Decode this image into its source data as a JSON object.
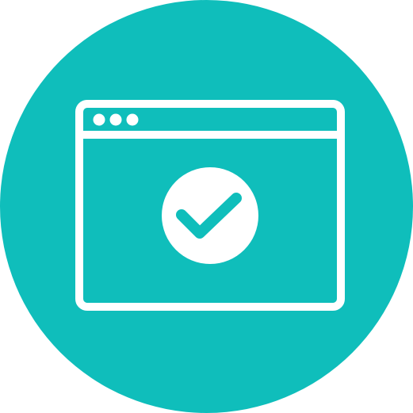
{
  "icon": {
    "name": "browser-window-check-icon",
    "colors": {
      "circle_background": "#0FBEBB",
      "foreground": "#FFFFFF",
      "page_background": "#FFFFFF"
    },
    "parts": {
      "window_dots": [
        "window-dot-1",
        "window-dot-2",
        "window-dot-3"
      ],
      "center_badge": "check-badge-icon",
      "badge_mark": "checkmark-icon"
    }
  }
}
